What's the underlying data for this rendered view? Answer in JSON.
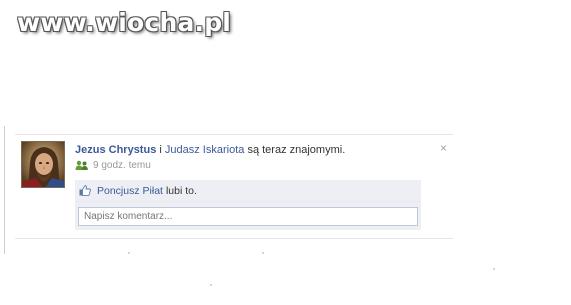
{
  "watermark": "www.wiocha.pl",
  "post": {
    "actor": "Jezus Chrystus",
    "conjunction": "i",
    "friend": "Judasz Iskariota",
    "action": "są teraz znajomymi.",
    "time": "9 godz. temu",
    "close_glyph": "×",
    "avatar_icon": "jesus-portrait"
  },
  "likes": {
    "liker": "Poncjusz Piłat",
    "text": "lubi to."
  },
  "comment": {
    "placeholder": "Napisz komentarz..."
  },
  "colors": {
    "link": "#3b5998",
    "ufi_background": "#edeff4",
    "input_border": "#bdc7d8"
  }
}
